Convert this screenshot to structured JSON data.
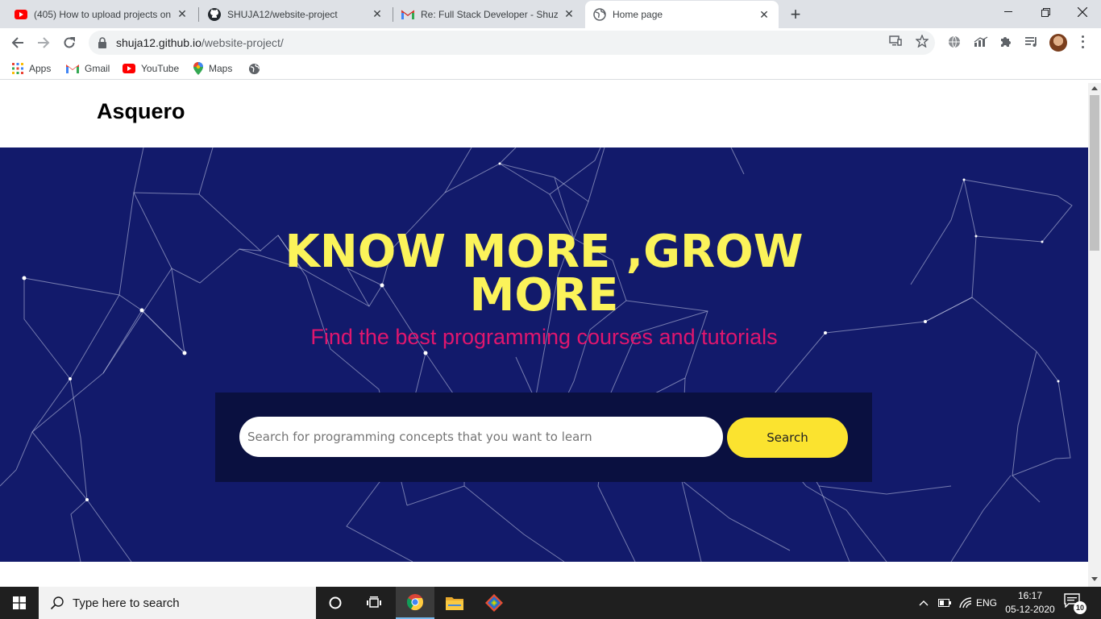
{
  "browser": {
    "tabs": [
      {
        "title": "(405) How to upload projects on",
        "icon": "youtube-icon"
      },
      {
        "title": "SHUJA12/website-project",
        "icon": "github-icon"
      },
      {
        "title": "Re: Full Stack Developer - Shuza",
        "icon": "gmail-icon"
      },
      {
        "title": "Home page",
        "icon": "globe-icon",
        "active": true
      }
    ],
    "url_host": "shuja12.github.io",
    "url_path": "/website-project/",
    "bookmarks": [
      {
        "label": "Apps",
        "icon": "apps-grid-icon"
      },
      {
        "label": "Gmail",
        "icon": "gmail-icon"
      },
      {
        "label": "YouTube",
        "icon": "youtube-icon"
      },
      {
        "label": "Maps",
        "icon": "maps-pin-icon"
      },
      {
        "label": "",
        "icon": "globe-icon"
      }
    ]
  },
  "site": {
    "brand": "Asquero",
    "headline": "KNOW MORE ,GROW MORE",
    "subheadline": "Find the best programming courses and tutorials",
    "search_placeholder": "Search for programming concepts that you want to learn",
    "search_button": "Search"
  },
  "taskbar": {
    "search_placeholder": "Type here to search",
    "language": "ENG",
    "time": "16:17",
    "date": "05-12-2020",
    "notification_count": "10"
  },
  "colors": {
    "hero_bg": "#121a6b",
    "headline": "#fbf35a",
    "subheadline": "#e0166e",
    "search_button": "#fbe32f"
  }
}
